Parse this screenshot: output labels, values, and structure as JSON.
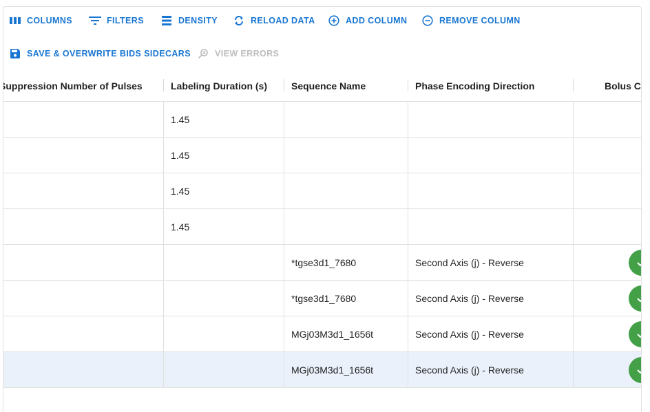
{
  "toolbar": {
    "columns": "COLUMNS",
    "filters": "FILTERS",
    "density": "DENSITY",
    "reload": "RELOAD DATA",
    "add_column": "ADD COLUMN",
    "remove_column": "REMOVE COLUMN",
    "save": "SAVE & OVERWRITE BIDS SIDECARS",
    "view_errors": "VIEW ERRORS"
  },
  "columns": [
    "Suppression Number of Pulses",
    "Labeling Duration (s)",
    "Sequence Name",
    "Phase Encoding Direction",
    "Bolus Cu"
  ],
  "rows": [
    {
      "suppression": "",
      "labeling": "1.45",
      "sequence": "",
      "phase": "",
      "bolus": false
    },
    {
      "suppression": "",
      "labeling": "1.45",
      "sequence": "",
      "phase": "",
      "bolus": false
    },
    {
      "suppression": "",
      "labeling": "1.45",
      "sequence": "",
      "phase": "",
      "bolus": false
    },
    {
      "suppression": "",
      "labeling": "1.45",
      "sequence": "",
      "phase": "",
      "bolus": false
    },
    {
      "suppression": "",
      "labeling": "",
      "sequence": "*tgse3d1_7680",
      "phase": "Second Axis (j) - Reverse",
      "bolus": true
    },
    {
      "suppression": "",
      "labeling": "",
      "sequence": "*tgse3d1_7680",
      "phase": "Second Axis (j) - Reverse",
      "bolus": true
    },
    {
      "suppression": "",
      "labeling": "",
      "sequence": "MGj03M3d1_1656t",
      "phase": "Second Axis (j) - Reverse",
      "bolus": true
    },
    {
      "suppression": "",
      "labeling": "",
      "sequence": "MGj03M3d1_1656t",
      "phase": "Second Axis (j) - Reverse",
      "bolus": true,
      "selected": true
    }
  ],
  "colors": {
    "accent": "#1976d2",
    "check_green": "#43a047",
    "selected_row": "#ebf1fa"
  },
  "icons": [
    "columns-icon",
    "filter-icon",
    "density-icon",
    "reload-icon",
    "add-circle-icon",
    "remove-circle-icon",
    "save-icon",
    "search-error-icon",
    "check-icon"
  ]
}
